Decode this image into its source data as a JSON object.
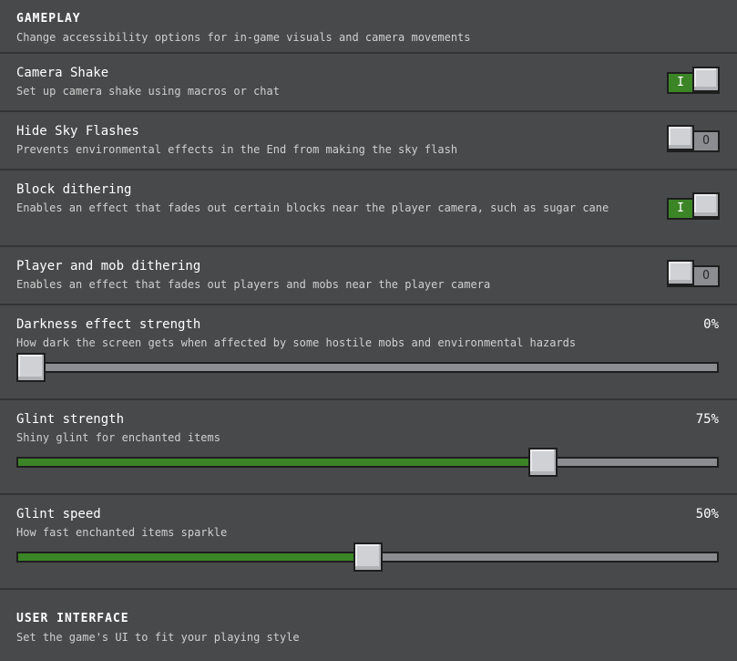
{
  "gameplay": {
    "title": "GAMEPLAY",
    "subtitle": "Change accessibility options for in-game visuals and camera movements"
  },
  "settings": {
    "camera_shake": {
      "title": "Camera Shake",
      "desc": "Set up camera shake using macros or chat",
      "enabled": true,
      "mark": "I"
    },
    "hide_sky_flashes": {
      "title": "Hide Sky Flashes",
      "desc": "Prevents environmental effects in the End from making the sky flash",
      "enabled": false,
      "mark": "O"
    },
    "block_dithering": {
      "title": "Block dithering",
      "desc": "Enables an effect that fades out certain blocks near the player camera, such as sugar cane",
      "enabled": true,
      "mark": "I"
    },
    "player_mob_dithering": {
      "title": "Player and mob dithering",
      "desc": "Enables an effect that fades out players and mobs near the player camera",
      "enabled": false,
      "mark": "O"
    },
    "darkness_effect": {
      "title": "Darkness effect strength",
      "desc": "How dark the screen gets when affected by some hostile mobs and environmental hazards",
      "value_label": "0%",
      "value": 0
    },
    "glint_strength": {
      "title": "Glint strength",
      "desc": "Shiny glint for enchanted items",
      "value_label": "75%",
      "value": 75
    },
    "glint_speed": {
      "title": "Glint speed",
      "desc": "How fast enchanted items sparkle",
      "value_label": "50%",
      "value": 50
    }
  },
  "user_interface": {
    "title": "USER INTERFACE",
    "subtitle": "Set the game's UI to fit your playing style"
  },
  "colors": {
    "toggle_on": "#3c8527",
    "toggle_off": "#8c8d90",
    "background": "#48494a"
  }
}
